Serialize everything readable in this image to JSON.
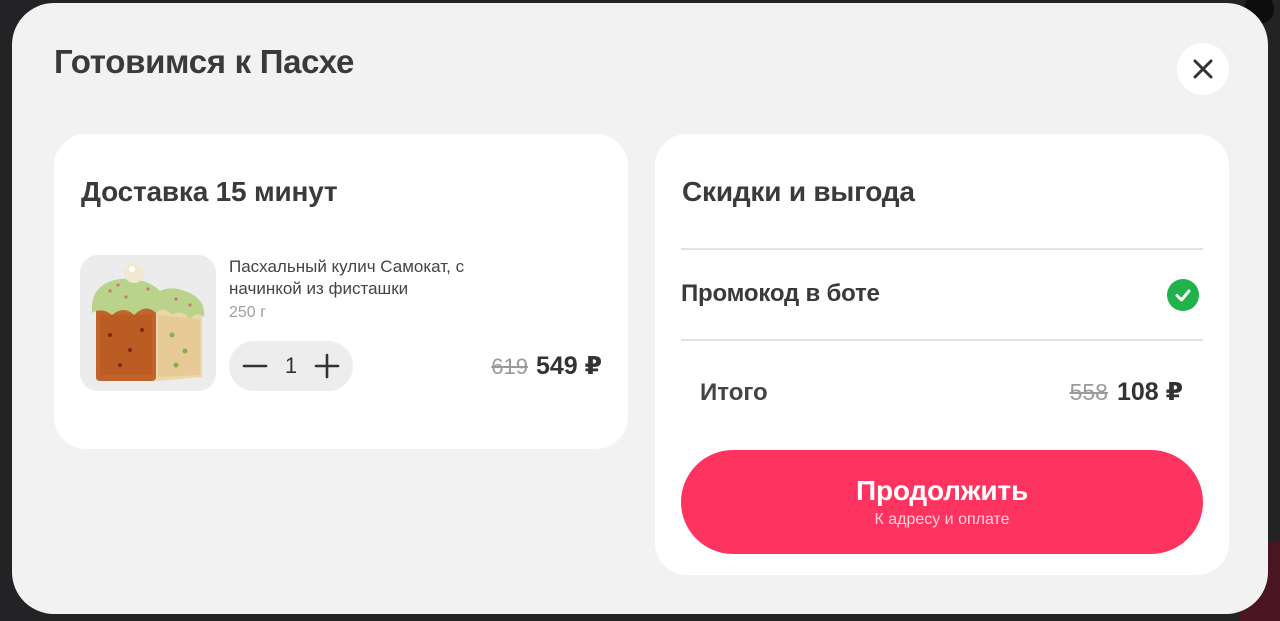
{
  "modal": {
    "title": "Готовимся к Пасхе",
    "close_icon": "close-icon"
  },
  "delivery": {
    "title": "Доставка 15 минут",
    "product": {
      "name": "Пасхальный кулич Самокат, с начинкой из фисташки",
      "weight": "250 г",
      "quantity": "1",
      "price_old": "619",
      "price_new": "549 ₽",
      "minus_icon": "minus-icon",
      "plus_icon": "plus-icon"
    }
  },
  "discounts": {
    "title": "Скидки и выгода",
    "promo_label": "Промокод в боте",
    "promo_status_icon": "check-circle-icon",
    "total_label": "Итого",
    "total_old": "558",
    "total_new": "108 ₽",
    "cta_title": "Продолжить",
    "cta_subtitle": "К адресу и оплате"
  },
  "colors": {
    "accent": "#ff335f",
    "success": "#22b24c",
    "modal_bg": "#f2f2f2",
    "card_bg": "#ffffff"
  }
}
